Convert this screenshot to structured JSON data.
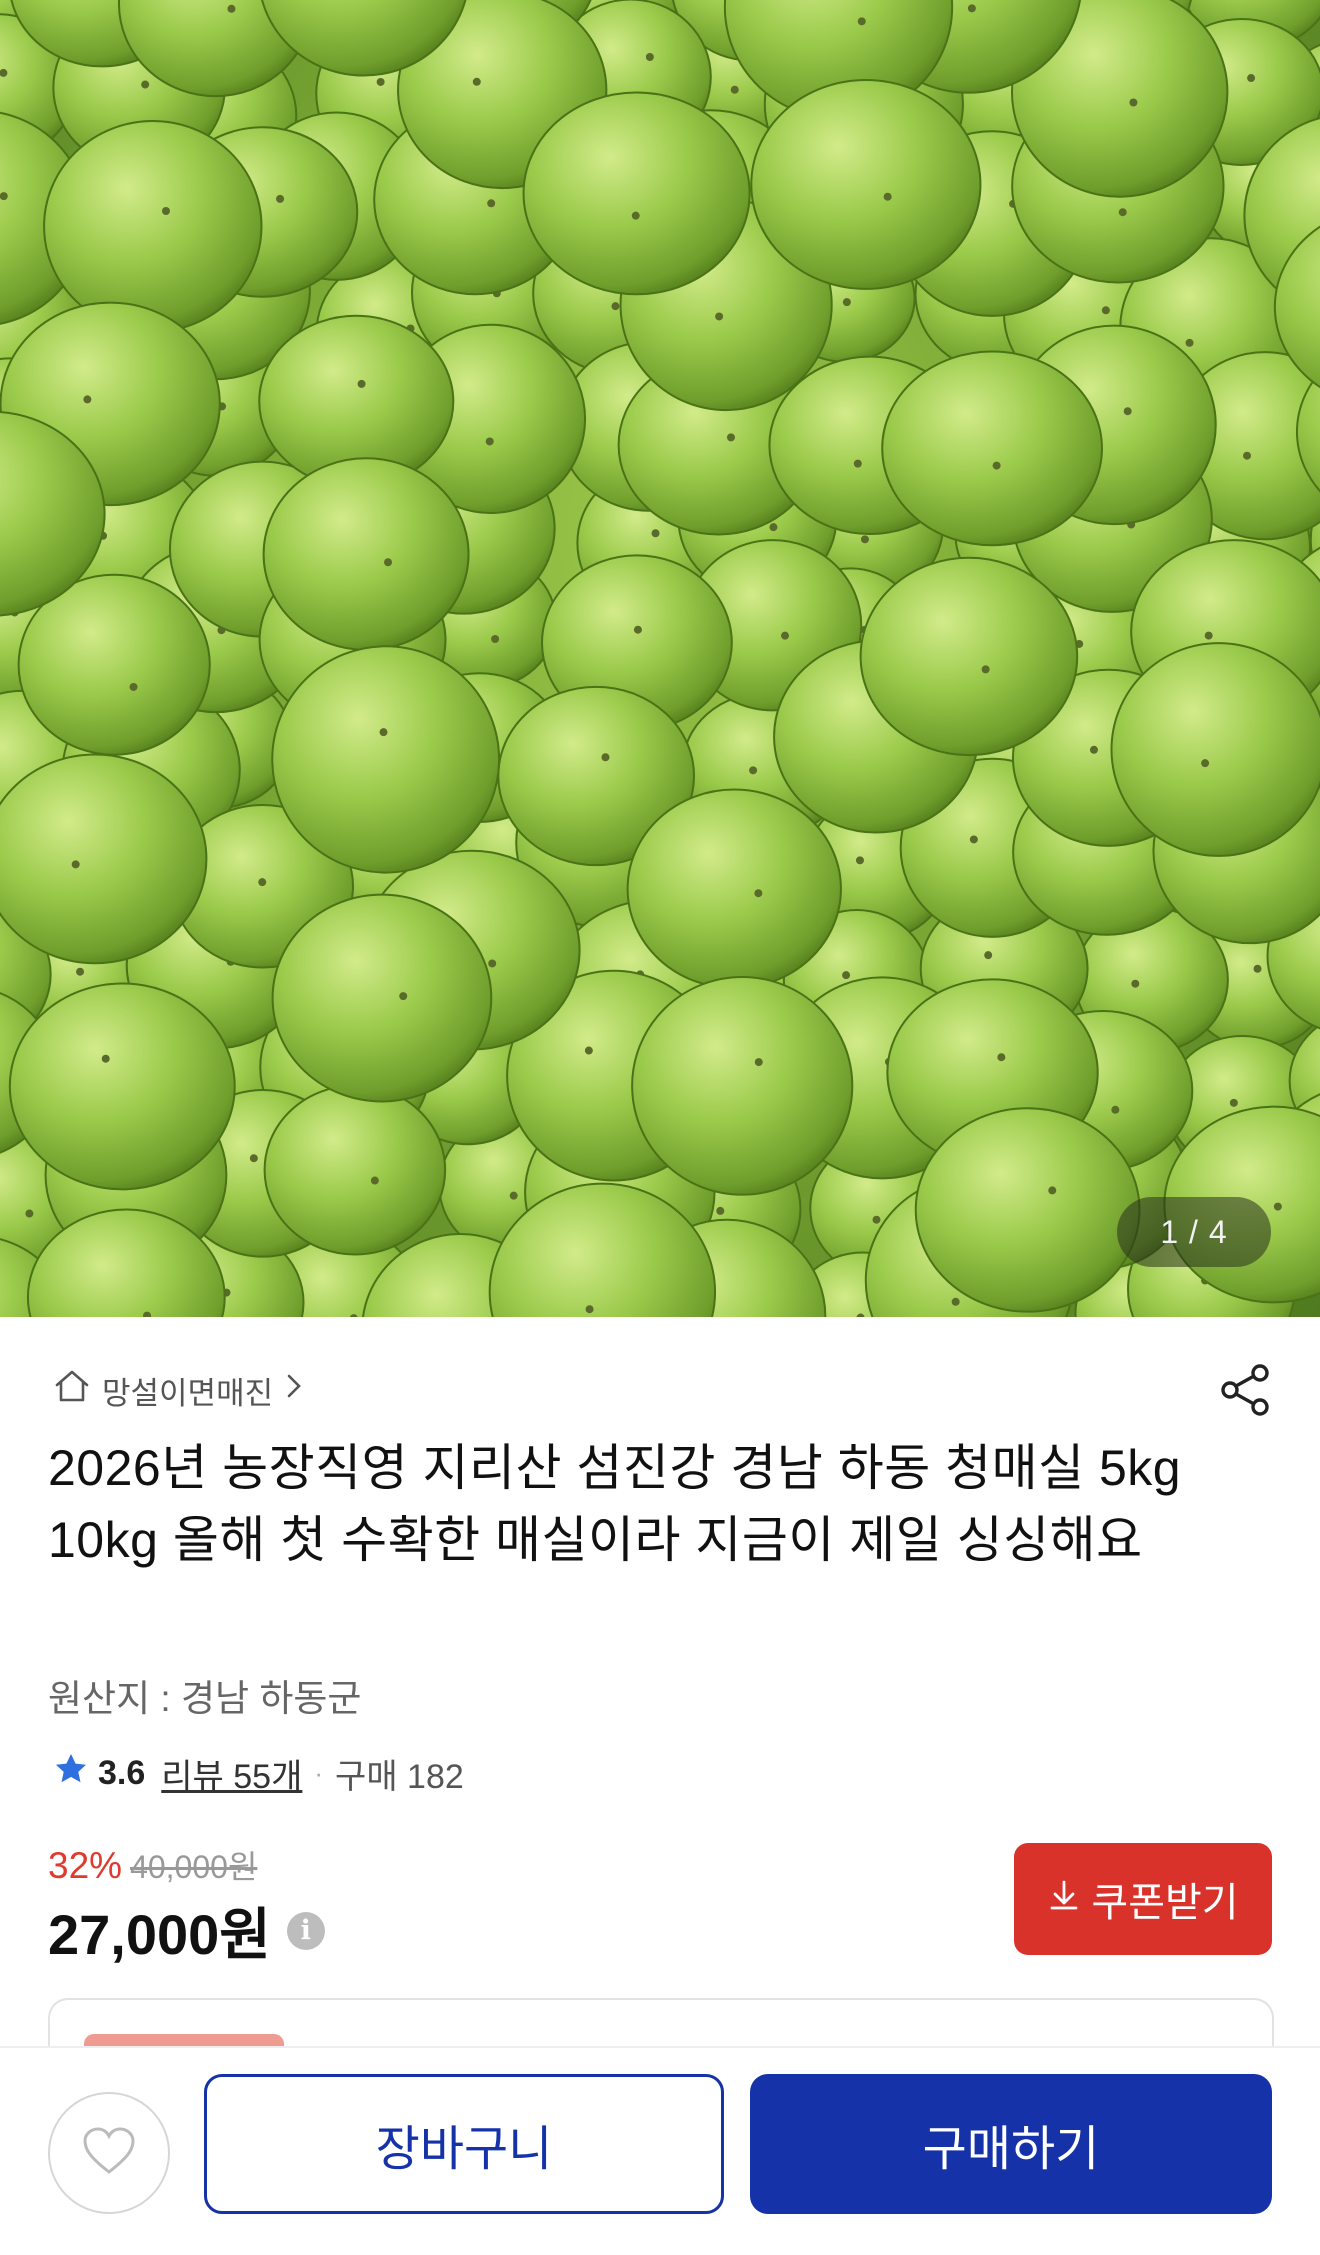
{
  "hero": {
    "image_description": "green plums",
    "page_indicator": "1 / 4"
  },
  "product": {
    "store_name": "망설이면매진",
    "title": "2026년 농장직영 지리산 섬진강 경남 하동 청매실 5kg 10kg 올해 첫 수확한 매실이라 지금이 제일 싱싱해요",
    "origin": "원산지 : 경남 하동군",
    "rating": "3.6",
    "reviews": "리뷰 55개",
    "separator": "·",
    "purchases": "구매 182",
    "discount": "32%",
    "original_price": "40,000원",
    "price": "27,000원",
    "info_glyph": "i",
    "coupon_label": "쿠폰받기"
  },
  "bottom_bar": {
    "cart_label": "장바구니",
    "buy_label": "구매하기"
  },
  "colors": {
    "accent_blue": "#1532a8",
    "coupon_red": "#d9322b",
    "discount_red": "#e03a2f",
    "star_blue": "#2f6fe0"
  },
  "icons": [
    "home-icon",
    "chevron-right-icon",
    "share-icon",
    "star-icon",
    "info-icon",
    "download-icon",
    "heart-icon"
  ]
}
